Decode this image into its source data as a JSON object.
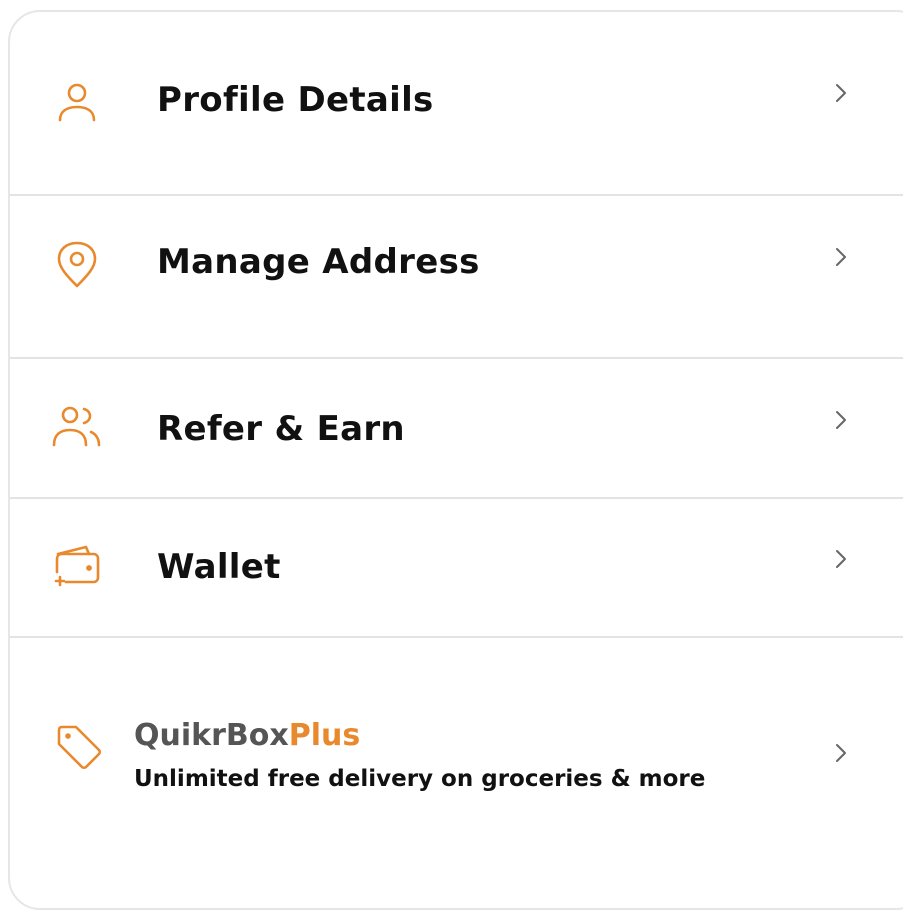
{
  "accent_color": "#e8892d",
  "menu": {
    "items": [
      {
        "label": "Profile Details",
        "icon": "user-icon"
      },
      {
        "label": "Manage Address",
        "icon": "location-pin-icon"
      },
      {
        "label": "Refer & Earn",
        "icon": "users-icon"
      },
      {
        "label": "Wallet",
        "icon": "wallet-icon"
      }
    ],
    "membership": {
      "brand_prefix": "QuikrBox",
      "brand_suffix": "Plus",
      "subtitle": "Unlimited free delivery on groceries & more",
      "icon": "tag-icon"
    },
    "chevron_icon": "chevron-right-icon"
  }
}
